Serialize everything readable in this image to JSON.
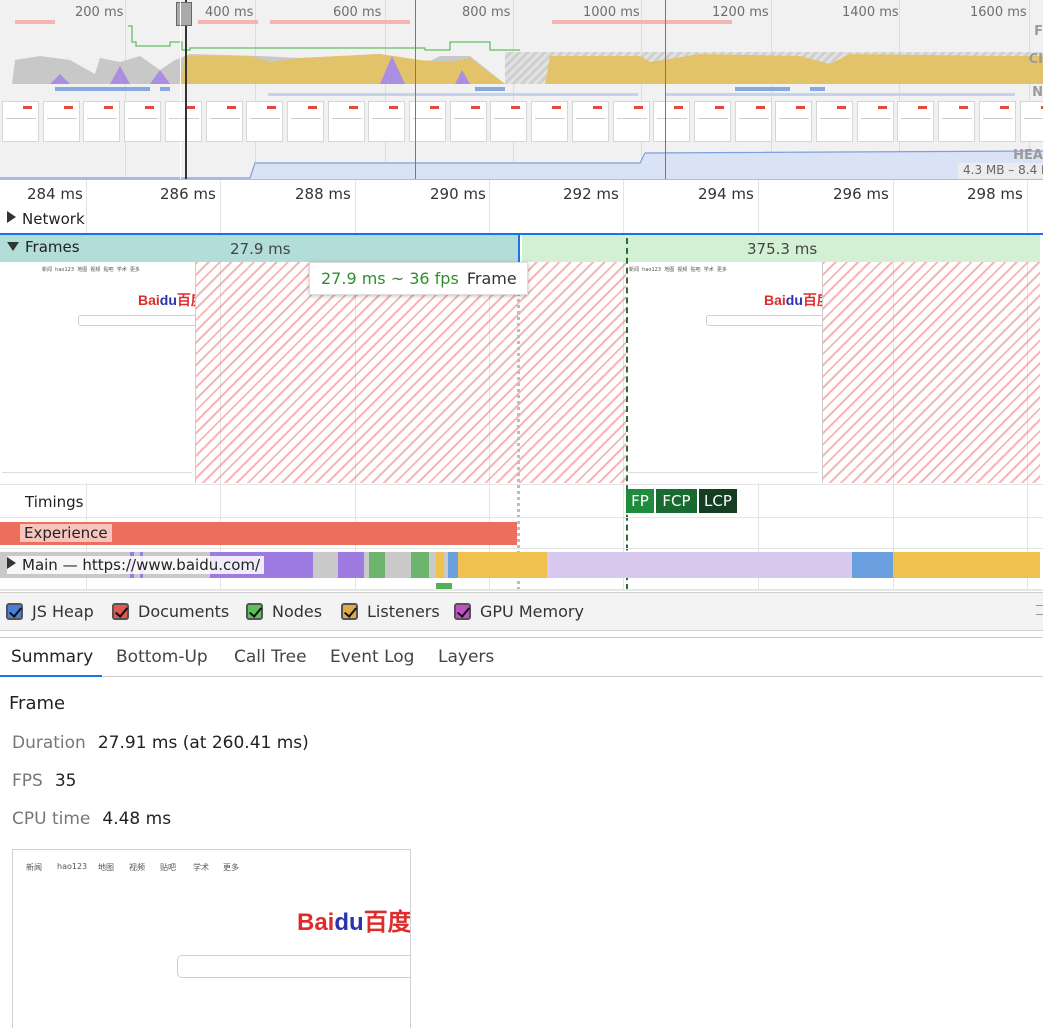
{
  "overview": {
    "ticks": [
      "200 ms",
      "400 ms",
      "600 ms",
      "800 ms",
      "1000 ms",
      "1200 ms",
      "1400 ms",
      "1600 ms"
    ],
    "row_labels": [
      "F",
      "CI",
      "N",
      "HEA"
    ],
    "heap_range": "4.3 MB – 8.4 I"
  },
  "ruler": {
    "ticks": [
      "284 ms",
      "286 ms",
      "288 ms",
      "290 ms",
      "292 ms",
      "294 ms",
      "296 ms",
      "298 ms"
    ]
  },
  "tracks": {
    "network_label": "Network",
    "frames_label": "Frames",
    "frame_selected_duration": "27.9 ms",
    "frame_next_duration": "375.3 ms",
    "timings_label": "Timings",
    "experience_label": "Experience",
    "main_label": "Main — https://www.baidu.com/"
  },
  "tooltip": {
    "value": "27.9 ms ~ 36 fps",
    "label": "Frame"
  },
  "timing_markers": {
    "fp": "FP",
    "fcp": "FCP",
    "lcp": "LCP"
  },
  "screenshot": {
    "nav": [
      "新闻",
      "hao123",
      "地图",
      "视频",
      "贴吧",
      "学术",
      "更多"
    ],
    "logo_left": "Bai",
    "logo_paw": "du",
    "logo_right": "百度"
  },
  "legend": {
    "items": [
      {
        "label": "JS Heap",
        "color": "#4a7fd9"
      },
      {
        "label": "Documents",
        "color": "#e2584e"
      },
      {
        "label": "Nodes",
        "color": "#5bbf5b"
      },
      {
        "label": "Listeners",
        "color": "#e0ac4a"
      },
      {
        "label": "GPU Memory",
        "color": "#c24fc8"
      }
    ]
  },
  "tabs": [
    "Summary",
    "Bottom-Up",
    "Call Tree",
    "Event Log",
    "Layers"
  ],
  "summary": {
    "title": "Frame",
    "duration_key": "Duration",
    "duration_value": "27.91 ms (at 260.41 ms)",
    "fps_key": "FPS",
    "fps_value": "35",
    "cpu_key": "CPU time",
    "cpu_value": "4.48 ms"
  },
  "colors": {
    "scripting": "#f0c14e",
    "rendering": "#9d7be0",
    "painting": "#6db56d",
    "system": "#c9c9c9",
    "loading": "#6a9fe0",
    "idle_frame": "#d4f0d4",
    "selected_frame": "#b3ddd8",
    "experience": "#ec6f5e",
    "timing_fp": "#1e8b3d",
    "timing_fcp": "#186a31",
    "timing_lcp": "#153d22"
  }
}
